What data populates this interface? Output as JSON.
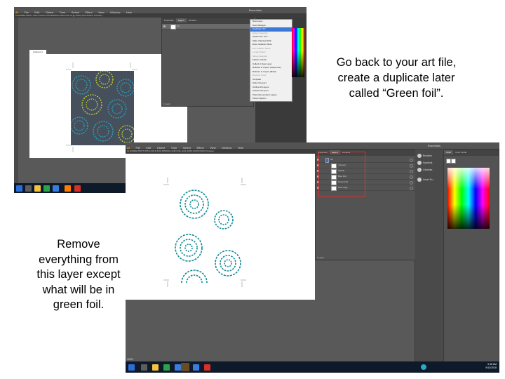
{
  "caption_top": {
    "line1": "Go back to your art file,",
    "line2": "create a duplicate later",
    "line3": "called “Green foil”."
  },
  "caption_left": {
    "line1": "Remove",
    "line2": "everything from",
    "line3": "this layer except",
    "line4": "what will be in",
    "line5": "green foil."
  },
  "app": {
    "logo": "Ai",
    "menu": [
      "File",
      "Edit",
      "Object",
      "Type",
      "Select",
      "Effect",
      "View",
      "Window",
      "Help"
    ],
    "workspace": "Essentials"
  },
  "shot1": {
    "doc_tab": "CLOVERE PRINT WITH GOLD FOIL BINDING AND FOIL.AI @ 100% (CMYK/GPU Preview)",
    "artboard_label": "Artboard 1",
    "panel_tabs": [
      "Properties",
      "Layers",
      "Libraries"
    ],
    "layers": [
      {
        "name": "Art"
      }
    ],
    "layer_count": "1 Layer",
    "context_menu": [
      {
        "label": "New Layer...",
        "state": "normal"
      },
      {
        "label": "New Sublayer...",
        "state": "normal"
      },
      {
        "label": "Duplicate \"Art\"",
        "state": "selected"
      },
      {
        "label": "Delete Selection",
        "state": "disabled"
      },
      {
        "label": "Options for \"Art\"...",
        "state": "normal"
      },
      {
        "label": "Make Clipping Mask",
        "state": "normal"
      },
      {
        "label": "Enter Isolation Mode",
        "state": "normal"
      },
      {
        "label": "Exit Isolation Mode",
        "state": "disabled"
      },
      {
        "label": "Locate Object",
        "state": "disabled"
      },
      {
        "label": "Merge Selected",
        "state": "disabled"
      },
      {
        "label": "Flatten Artwork",
        "state": "normal"
      },
      {
        "label": "Collect in New Layer",
        "state": "normal"
      },
      {
        "label": "Release to Layers (Sequence)",
        "state": "normal"
      },
      {
        "label": "Release to Layers (Build)",
        "state": "normal"
      },
      {
        "label": "Reverse Order",
        "state": "disabled"
      },
      {
        "label": "Template",
        "state": "normal"
      },
      {
        "label": "Hide All Layers",
        "state": "normal"
      },
      {
        "label": "Outline All Layers",
        "state": "normal"
      },
      {
        "label": "Unlock All Layers",
        "state": "normal"
      },
      {
        "label": "Paste Remembers Layers",
        "state": "normal"
      },
      {
        "label": "Panel Options...",
        "state": "normal"
      }
    ]
  },
  "shot2": {
    "doc_tab": "CLOVERE PRINT WITH GOLD FOIL BINDING AND FOIL.AI @ 100% (CMYK/GPU Preview)",
    "panel_tabs": [
      "Properties",
      "Layers",
      "Libraries"
    ],
    "layers": [
      {
        "name": "Art"
      },
      {
        "name": "<Group>"
      },
      {
        "name": "Spirals"
      },
      {
        "name": "Blue Foil"
      },
      {
        "name": "Green Foil"
      },
      {
        "name": "Pink Copy"
      }
    ],
    "layer_count": "1 Layer",
    "right_panel": [
      "Brushes",
      "Symbols",
      "Libraries",
      "Asset Ex..."
    ],
    "color_tabs": [
      "Color",
      "Color Guide"
    ],
    "zoom": "100%",
    "clock_time": "9:46 AM",
    "clock_date": "9/12/2018"
  },
  "colors": {
    "ui_dark": "#535353",
    "highlight_box": "#e03030",
    "teal": "#0e8a96",
    "pattern_bg": "#45505c"
  }
}
